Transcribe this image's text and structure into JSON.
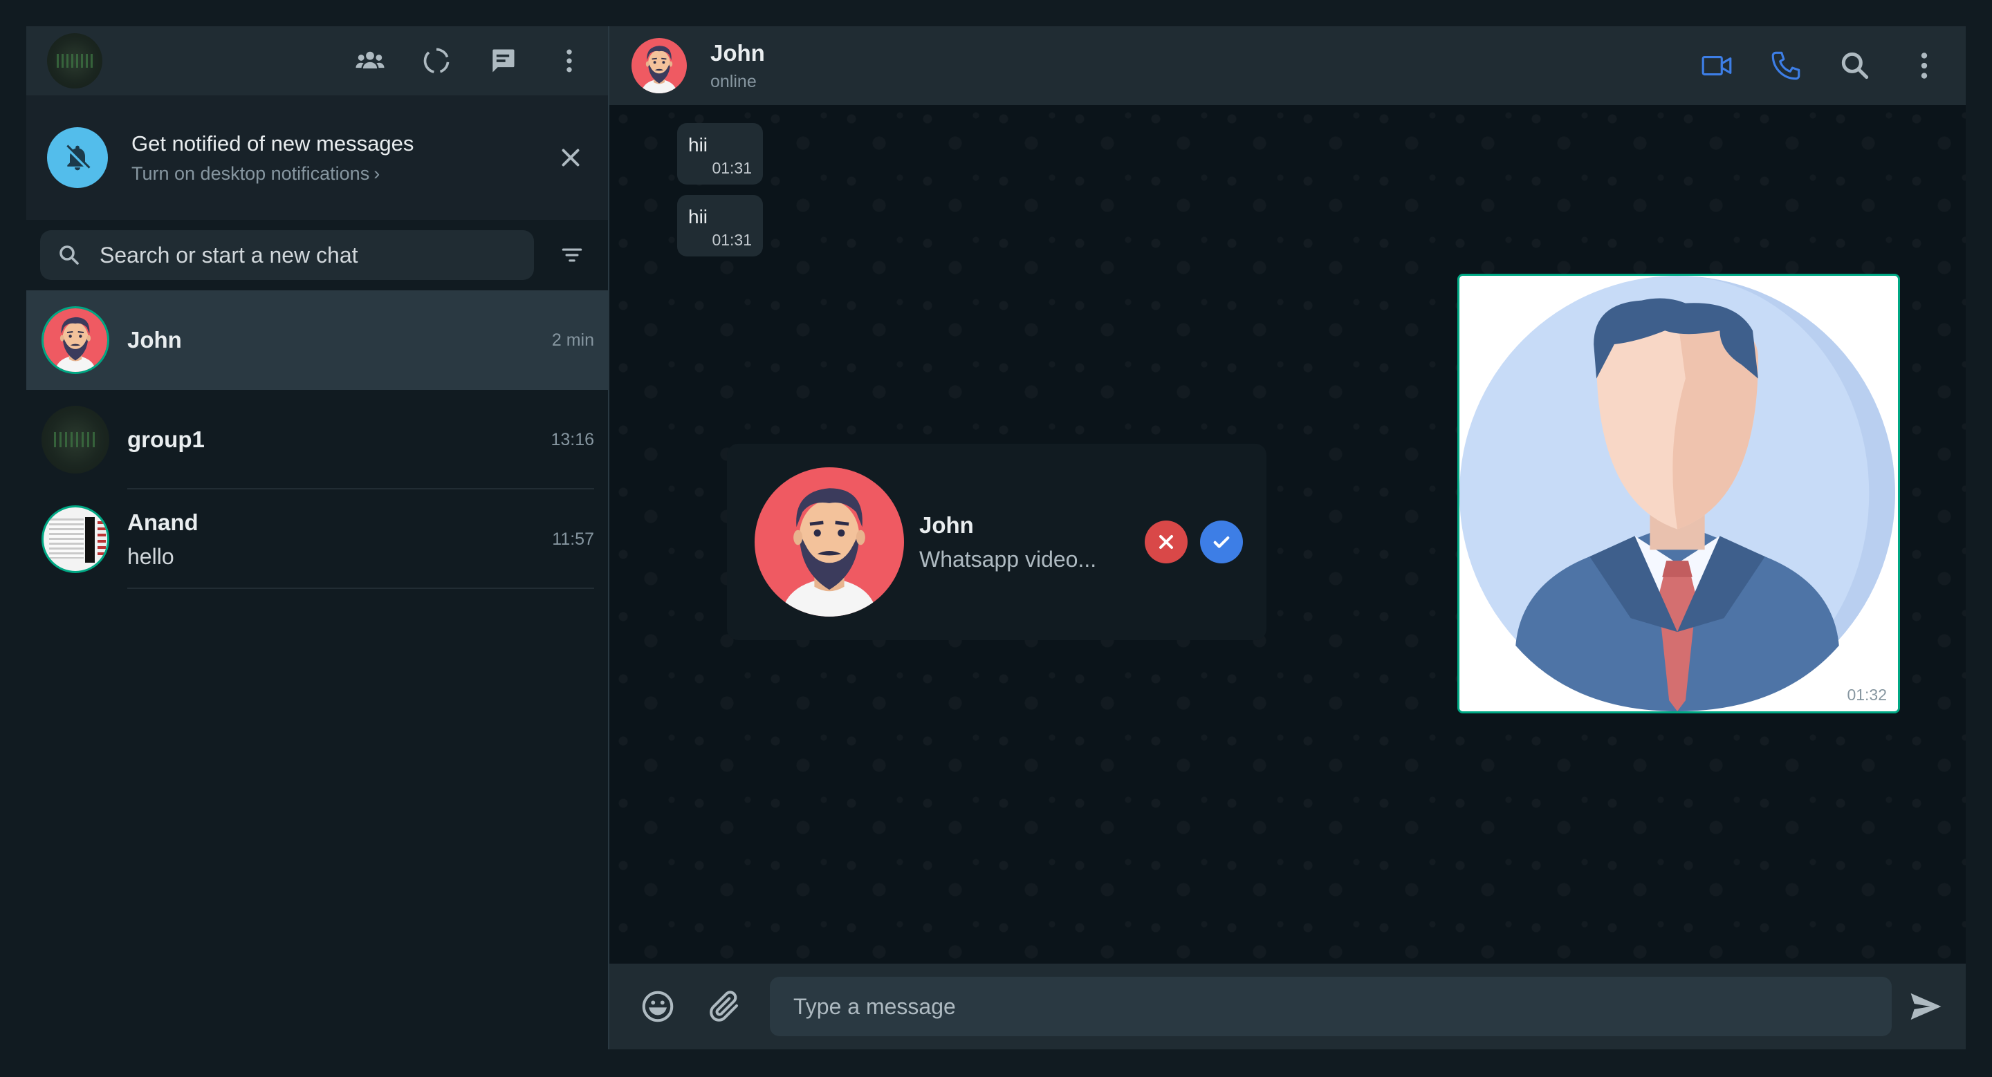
{
  "sidebar": {
    "header_icons": [
      "communities-icon",
      "status-icon",
      "new-chat-icon",
      "menu-icon"
    ],
    "notification": {
      "title": "Get notified of new messages",
      "subtitle": "Turn on desktop notifications",
      "chevron": "›"
    },
    "search": {
      "placeholder": "Search or start a new chat"
    },
    "chats": [
      {
        "name": "John",
        "time": "2 min",
        "last": "",
        "active": true
      },
      {
        "name": "group1",
        "time": "13:16",
        "last": "",
        "active": false
      },
      {
        "name": "Anand",
        "time": "11:57",
        "last": "hello",
        "active": false
      }
    ]
  },
  "conversation": {
    "name": "John",
    "status": "online",
    "messages": [
      {
        "text": "hii",
        "time": "01:31"
      },
      {
        "text": "hii",
        "time": "01:31"
      }
    ],
    "image_message": {
      "time": "01:32"
    },
    "incoming_call": {
      "name": "John",
      "description": "Whatsapp video..."
    },
    "composer": {
      "placeholder": "Type a message"
    }
  },
  "colors": {
    "accent": "#00a884",
    "icon_blue": "#3d7ee6",
    "decline_red": "#d94848",
    "notify_blue": "#53bdeb",
    "panel": "#202c33",
    "background": "#111b21"
  }
}
